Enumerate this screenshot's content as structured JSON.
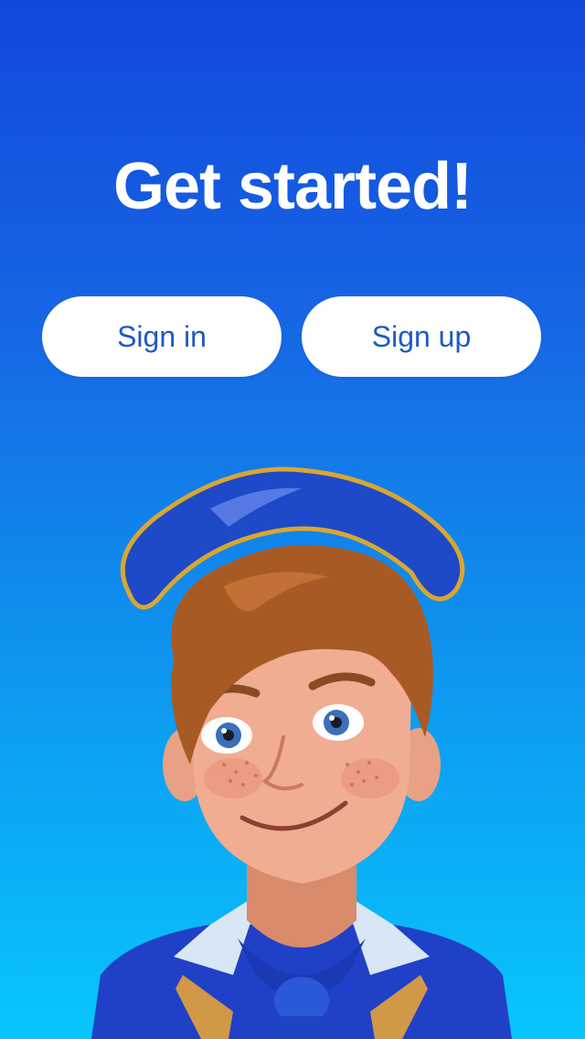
{
  "screen": {
    "title": "Get started!",
    "sign_in_label": "Sign in",
    "sign_up_label": "Sign up"
  },
  "colors": {
    "background_top": "#1148dc",
    "background_bottom": "#08c6fb",
    "button_background": "#ffffff",
    "button_text": "#1e58c8"
  },
  "illustration": {
    "icon": "sailor-boy-mascot"
  }
}
